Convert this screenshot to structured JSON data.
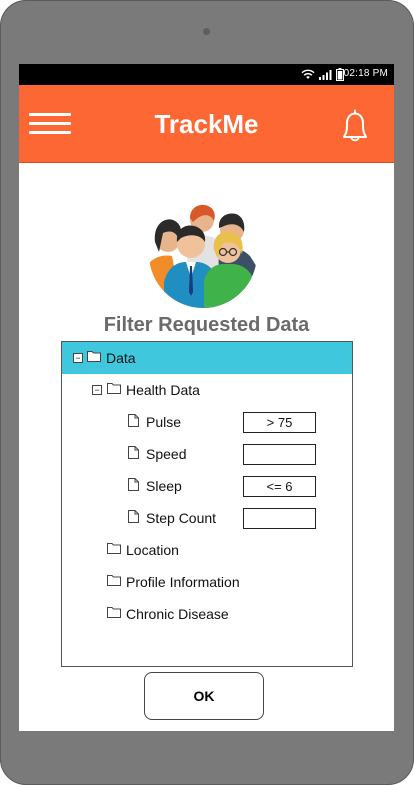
{
  "status_bar": {
    "time": "02:18 PM",
    "icons": [
      "wifi-icon",
      "signal-icon",
      "battery-icon"
    ]
  },
  "app_bar": {
    "title": "TrackMe",
    "menu_icon": "hamburger-menu-icon",
    "notification_icon": "bell-icon"
  },
  "colors": {
    "app_bar": "#fc6734",
    "selected_row": "#3fc7de",
    "heading": "#6a6a6a"
  },
  "page": {
    "heading": "Filter Requested Data"
  },
  "tree": {
    "root": {
      "label": "Data",
      "expanded": true,
      "selected": true
    },
    "health": {
      "label": "Health Data",
      "expanded": true
    },
    "metrics": [
      {
        "label": "Pulse",
        "value": "> 75"
      },
      {
        "label": "Speed",
        "value": ""
      },
      {
        "label": "Sleep",
        "value": "<= 6"
      },
      {
        "label": "Step Count",
        "value": ""
      }
    ],
    "folders": [
      {
        "label": "Location"
      },
      {
        "label": "Profile Information"
      },
      {
        "label": "Chronic Disease"
      }
    ]
  },
  "actions": {
    "ok_label": "OK"
  }
}
